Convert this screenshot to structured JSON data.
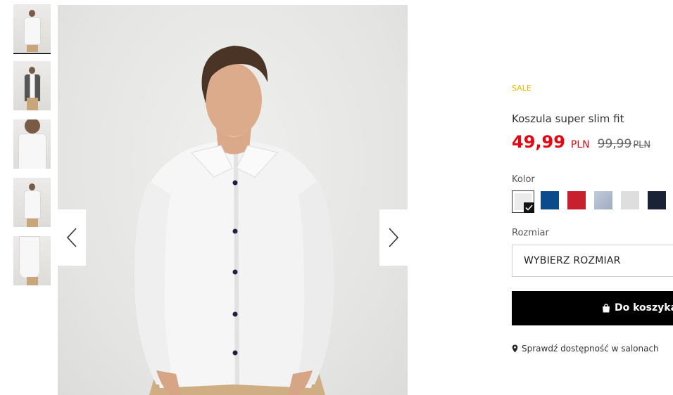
{
  "thumbnails": [
    {
      "alt": "front",
      "variant": "front"
    },
    {
      "alt": "full outfit",
      "variant": "blazer"
    },
    {
      "alt": "collar close-up",
      "variant": "close"
    },
    {
      "alt": "back",
      "variant": "front"
    },
    {
      "alt": "cuff detail",
      "variant": "arm"
    }
  ],
  "gallery": {
    "prev_icon": "chevron-left-icon",
    "next_icon": "chevron-right-icon"
  },
  "product": {
    "badge": "SALE",
    "title": "Koszula super slim fit",
    "price": "49,99",
    "currency": "PLN",
    "old_price": "99,99",
    "old_currency": "PLN"
  },
  "color": {
    "label": "Kolor",
    "options": [
      {
        "hex": "#ebebeb",
        "selected": true
      },
      {
        "hex": "#0b4a8b",
        "selected": false
      },
      {
        "hex": "#c7202f",
        "selected": false
      },
      {
        "hex": "#aab7cc",
        "selected": false
      },
      {
        "hex": "#dedede",
        "selected": false
      },
      {
        "hex": "#1b2236",
        "selected": false
      }
    ]
  },
  "size": {
    "label": "Rozmiar",
    "placeholder": "WYBIERZ ROZMIAR"
  },
  "cart": {
    "label": "Do koszyka",
    "icon": "shopping-bag-icon"
  },
  "availability": {
    "label": "Sprawdź dostępność w salonach",
    "icon": "location-pin-icon"
  },
  "colors": {
    "sale": "#f2b705",
    "price": "#e30613",
    "button": "#000000"
  }
}
